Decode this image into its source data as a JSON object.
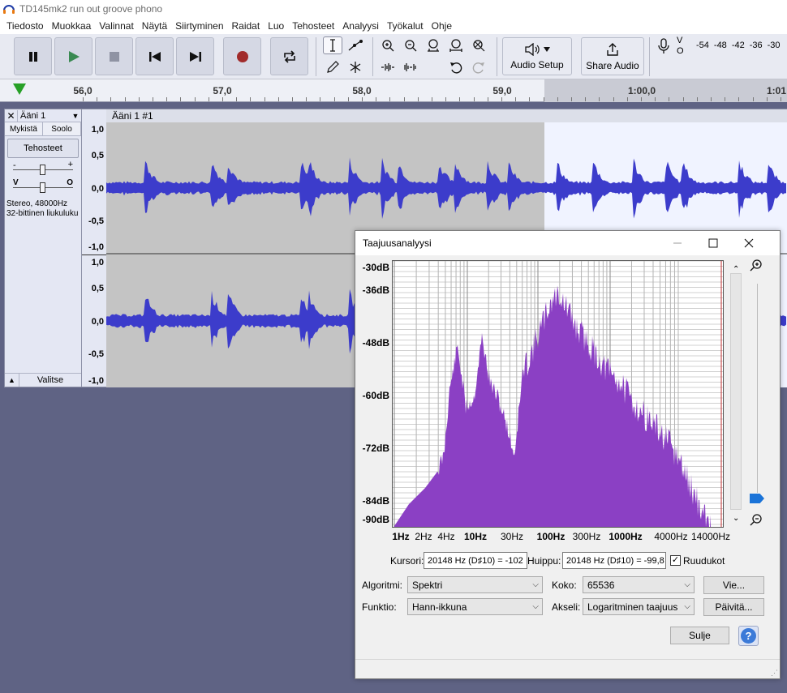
{
  "window": {
    "title": "TD145mk2 run out groove phono"
  },
  "menu": [
    "Tiedosto",
    "Muokkaa",
    "Valinnat",
    "Näytä",
    "Siirtyminen",
    "Raidat",
    "Luo",
    "Tehosteet",
    "Analyysi",
    "Työkalut",
    "Ohje"
  ],
  "toolbar": {
    "audio_setup": "Audio Setup",
    "share_audio": "Share Audio",
    "meter_channels": [
      "V",
      "O"
    ],
    "meter_scale": [
      "-54",
      "-48",
      "-42",
      "-36",
      "-30"
    ]
  },
  "ruler": {
    "labels": [
      "56,0",
      "57,0",
      "58,0",
      "59,0",
      "1:00,0",
      "1:01"
    ]
  },
  "track": {
    "name": "Ääni 1",
    "mute": "Mykistä",
    "solo": "Soolo",
    "effects": "Tehosteet",
    "gain_minus": "-",
    "gain_plus": "+",
    "pan_left": "V",
    "pan_right": "O",
    "format_line1": "Stereo, 48000Hz",
    "format_line2": "32-bittinen liukuluku",
    "select": "Valitse",
    "clip_name": "Ääni 1 #1",
    "scale_top": [
      "1,0",
      "0,5",
      "0,0",
      "-0,5",
      "-1,0"
    ],
    "scale_bottom": [
      "1,0",
      "0,5",
      "0,0",
      "-0,5",
      "-1,0"
    ]
  },
  "dialog": {
    "title": "Taajuusanalyysi",
    "y_labels": [
      "-30dB",
      "-36dB",
      "-48dB",
      "-60dB",
      "-72dB",
      "-84dB",
      "-90dB"
    ],
    "x_labels": [
      "1Hz",
      "2Hz",
      "4Hz",
      "10Hz",
      "30Hz",
      "100Hz",
      "300Hz",
      "1000Hz",
      "4000Hz",
      "14000Hz"
    ],
    "cursor_label": "Kursori:",
    "cursor_value": "20148 Hz (D♯10) = -102",
    "peak_label": "Huippu:",
    "peak_value": "20148 Hz (D♯10) = -99,8",
    "grid_label": "Ruudukot",
    "grid_checked": true,
    "algorithm_label": "Algoritmi:",
    "algorithm_value": "Spektri",
    "size_label": "Koko:",
    "size_value": "65536",
    "export_button": "Vie...",
    "function_label": "Funktio:",
    "function_value": "Hann-ikkuna",
    "axis_label": "Akseli:",
    "axis_value": "Logaritminen taajuus",
    "update_button": "Päivitä...",
    "close_button": "Sulje",
    "help_button": "?"
  },
  "colors": {
    "waveform": "#3c3ccb",
    "spectrum_fill": "#8b40c4",
    "background": "#5f6384",
    "selection": "#f0f3ff"
  }
}
